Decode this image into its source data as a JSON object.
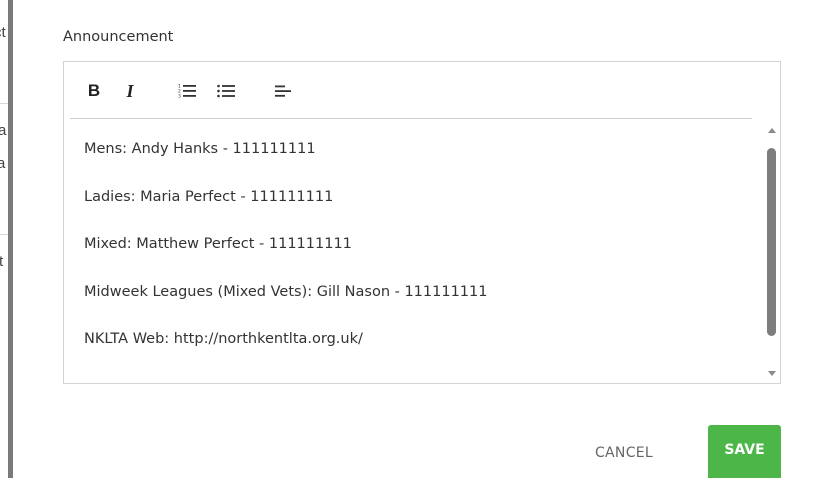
{
  "background": {
    "fragments": [
      "ct",
      "a",
      "a",
      "t"
    ]
  },
  "dialog": {
    "field_label": "Announcement",
    "toolbar": {
      "bold_label": "B",
      "italic_label": "I",
      "icons": [
        "ordered-list-icon",
        "bulleted-list-icon",
        "align-left-icon"
      ]
    },
    "content_lines": [
      "Mens: Andy Hanks - 111111111",
      "Ladies: Maria Perfect - 111111111",
      "Mixed: Matthew Perfect - 111111111",
      "Midweek Leagues (Mixed Vets): Gill Nason - 111111111",
      "NKLTA Web: http://northkentlta.org.uk/"
    ],
    "cancel_label": "CANCEL",
    "save_label": "SAVE"
  },
  "colors": {
    "save_button": "#4cb748",
    "border": "#d3d3d3",
    "scroll_thumb": "#7d7d7d"
  }
}
